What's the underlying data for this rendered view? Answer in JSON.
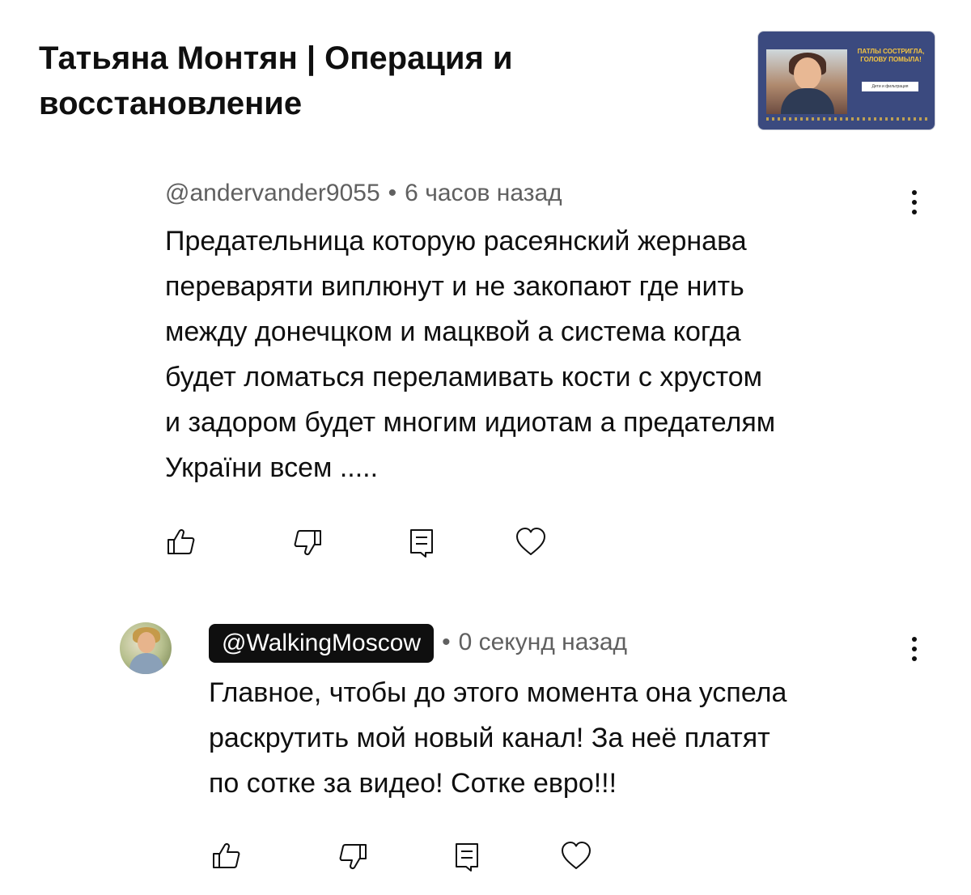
{
  "video": {
    "title_line1": "Татьяна Монтян | Операция и",
    "title_line2": "восстановление",
    "thumbnail": {
      "caption_line1": "ПАТЛЫ СОСТРИГЛА,",
      "caption_line2": "ГОЛОВУ ПОМЫЛА!",
      "tag": "Дети и фильтрация"
    }
  },
  "comments": [
    {
      "author": "@andervander9055",
      "separator": "•",
      "time": "6 часов назад",
      "lines": [
        "Предательница которую расеянский жернава",
        "переваряти виплюнут и не закопают где нить",
        "между донечцком и мацквой а система когда",
        "будет ломаться переламивать кости с хрустом",
        "и задором будет многим идиотам а предателям",
        "Украïни всем ....."
      ],
      "actions": [
        "like-icon",
        "dislike-icon",
        "reply-icon",
        "heart-icon"
      ]
    },
    {
      "author": "@WalkingMoscow",
      "separator": "•",
      "time": "0 секунд назад",
      "lines": [
        "Главное, чтобы до этого момента она успела",
        "раскрутить мой новый канал! За неё платят",
        "по сотке за видео! Сотке евро!!!"
      ],
      "actions": [
        "like-icon",
        "dislike-icon",
        "reply-icon",
        "heart-icon"
      ]
    }
  ]
}
